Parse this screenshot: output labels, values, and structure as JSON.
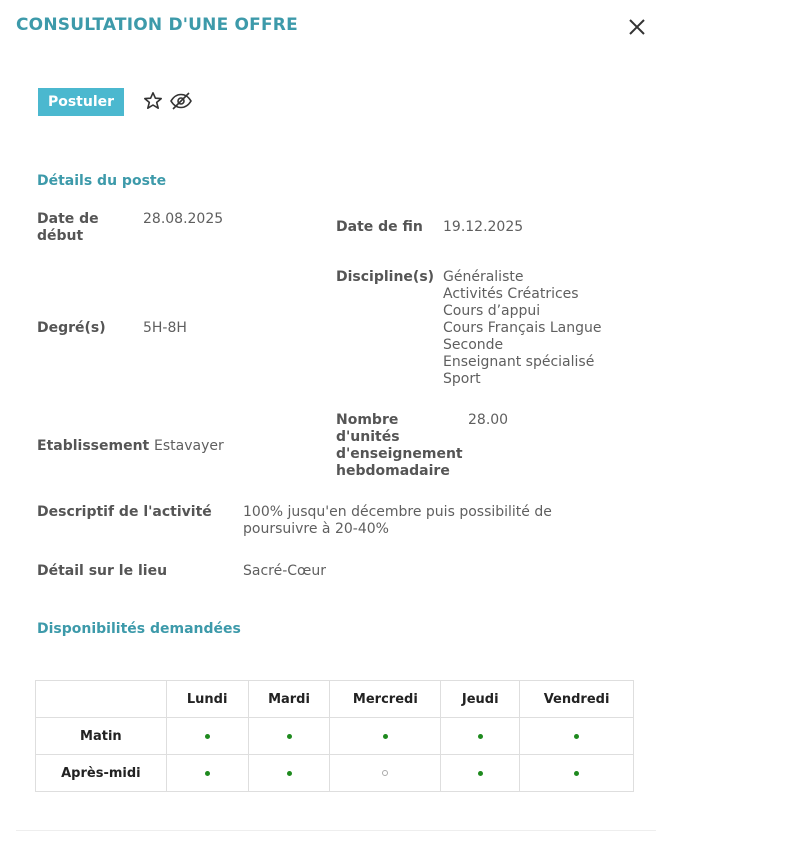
{
  "dialog": {
    "title": "CONSULTATION D'UNE OFFRE"
  },
  "actions": {
    "apply_label": "Postuler",
    "favorite_icon": "star-outline-icon",
    "hide_icon": "eye-slash-icon"
  },
  "details": {
    "section_title": "Détails du poste",
    "start_date": {
      "label": "Date de début",
      "value": "28.08.2025"
    },
    "end_date": {
      "label": "Date de fin",
      "value": "19.12.2025"
    },
    "degrees": {
      "label": "Degré(s)",
      "value": "5H-8H"
    },
    "disciplines": {
      "label": "Discipline(s)",
      "values": [
        "Généraliste",
        "Activités Créatrices",
        "Cours d’appui",
        "Cours Français Langue Seconde",
        "Enseignant spécialisé",
        "Sport"
      ]
    },
    "establishment": {
      "label": "Etablissement",
      "value": "Estavayer"
    },
    "weekly_units": {
      "label": "Nombre d'unités d'enseignement hebdomadaire",
      "value": "28.00"
    },
    "activity_description": {
      "label": "Descriptif de l'activité",
      "value": "100% jusqu'en décembre puis possibilité de poursuivre à 20-40%"
    },
    "place_detail": {
      "label": "Détail sur le lieu",
      "value": "Sacré-Cœur"
    }
  },
  "availability": {
    "section_title": "Disponibilités demandées",
    "days": [
      "Lundi",
      "Mardi",
      "Mercredi",
      "Jeudi",
      "Vendredi"
    ],
    "rows": [
      {
        "label": "Matin",
        "slots": [
          true,
          true,
          true,
          true,
          true
        ]
      },
      {
        "label": "Après-midi",
        "slots": [
          true,
          true,
          false,
          true,
          true
        ]
      }
    ],
    "colors": {
      "available": "#1e8a1e",
      "unavailable": "#aaaaaa"
    }
  },
  "colors": {
    "accent": "#3d9aaa",
    "button": "#4bb8cf"
  }
}
